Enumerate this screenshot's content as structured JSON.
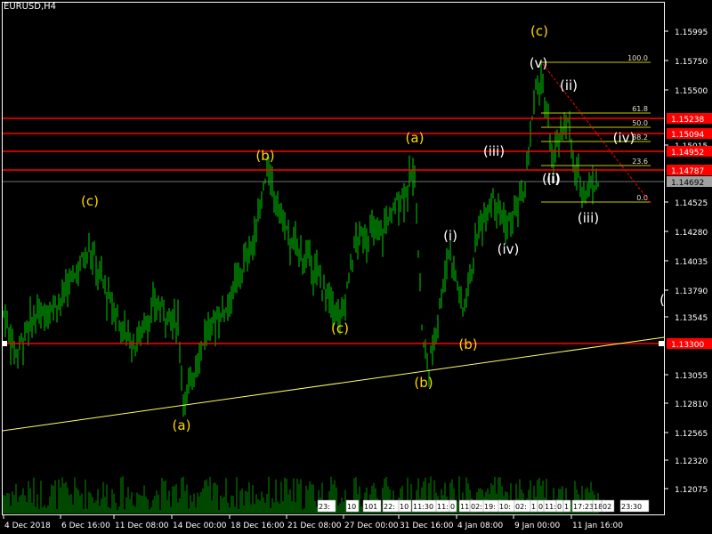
{
  "symbol": "EURUSD,H4",
  "colors": {
    "background": "#000000",
    "bull": "#00d000",
    "frame": "#ffffff",
    "level": "#ff0000",
    "trend": "#ffff66",
    "fib": "#c8c800",
    "wave_major": "#ffd700",
    "wave_minor": "#ffffff",
    "tag_text": "#000000"
  },
  "price_axis": {
    "ticks": [
      "1.15995",
      "1.15750",
      "1.15500",
      "1.15015",
      "1.14525",
      "1.14280",
      "1.14035",
      "1.13790",
      "1.13545",
      "1.13055",
      "1.12810",
      "1.12565",
      "1.12320",
      "1.12075"
    ],
    "tags": [
      {
        "text": "1.15238",
        "kind": "red"
      },
      {
        "text": "1.15094",
        "kind": "red"
      },
      {
        "text": "1.14952",
        "kind": "red"
      },
      {
        "text": "1.14787",
        "kind": "red"
      },
      {
        "text": "1.14692",
        "kind": "grey"
      },
      {
        "text": "1.13300",
        "kind": "red"
      }
    ]
  },
  "time_axis": {
    "labels": [
      "4 Dec 2018",
      "6 Dec 16:00",
      "11 Dec 08:00",
      "14 Dec 00:00",
      "18 Dec 16:00",
      "21 Dec 08:00",
      "27 Dec 00:00",
      "31 Dec 16:00",
      "4 Jan 08:00",
      "9 Jan 00:00",
      "11 Jan 16:00"
    ],
    "scroll_labels": [
      "23:",
      "10",
      "101",
      "22:",
      "10",
      "11:30",
      "11:",
      "0",
      "11:",
      "02:",
      "19:",
      "10:",
      "02:",
      "1",
      "0",
      "11:",
      "0",
      "1",
      "17:23",
      "18",
      "02",
      "23:30"
    ]
  },
  "fib_levels": [
    {
      "label": "100.0"
    },
    {
      "label": "61.8"
    },
    {
      "label": "50.0"
    },
    {
      "label": "38.2"
    },
    {
      "label": "23.6"
    },
    {
      "label": "0.0"
    }
  ],
  "wave_labels": [
    {
      "text": "(a)",
      "tier": "major"
    },
    {
      "text": "(b)",
      "tier": "major"
    },
    {
      "text": "(c)",
      "tier": "major"
    },
    {
      "text": "(a)",
      "tier": "major"
    },
    {
      "text": "(b)",
      "tier": "major"
    },
    {
      "text": "(c)",
      "tier": "major"
    },
    {
      "text": "(b)",
      "tier": "major"
    },
    {
      "text": "(c)",
      "tier": "major"
    },
    {
      "text": "(i)",
      "tier": "minor"
    },
    {
      "text": "(ii)",
      "tier": "minor"
    },
    {
      "text": "(iii)",
      "tier": "minor"
    },
    {
      "text": "(iv)",
      "tier": "minor"
    },
    {
      "text": "(v)",
      "tier": "minor"
    },
    {
      "text": "(ii)",
      "tier": "minor"
    },
    {
      "text": "(iv)",
      "tier": "minor"
    },
    {
      "text": "(i)",
      "tier": "minor"
    },
    {
      "text": "(iii)",
      "tier": "minor"
    },
    {
      "text": "(",
      "tier": "minor"
    }
  ]
}
